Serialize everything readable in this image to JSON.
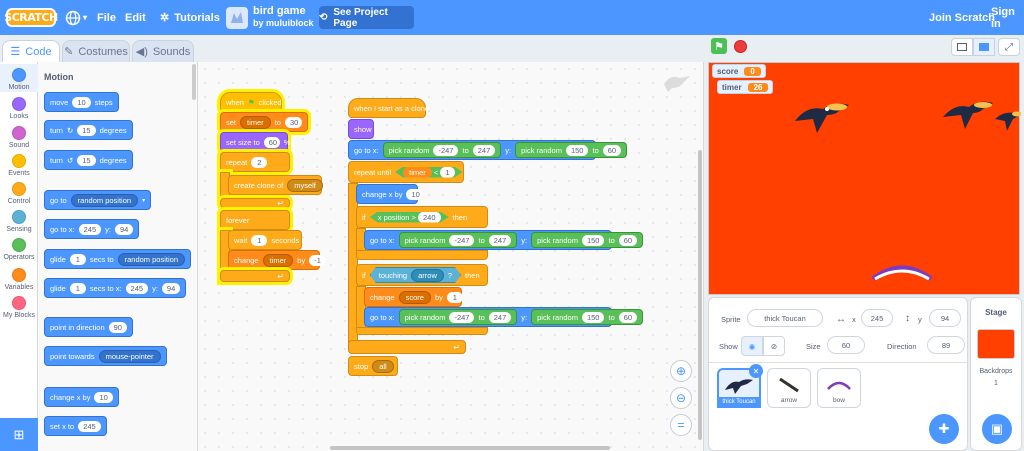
{
  "menu": {
    "logo": "SCRATCH",
    "file": "File",
    "edit": "Edit",
    "tutorials": "Tutorials",
    "project_title": "bird game",
    "project_author": "by muluiblock",
    "see_project": "See Project Page",
    "join": "Join Scratch",
    "signin": "Sign in"
  },
  "tabs": {
    "code": "Code",
    "costumes": "Costumes",
    "sounds": "Sounds"
  },
  "categories": [
    {
      "label": "Motion",
      "color": "#4c97ff"
    },
    {
      "label": "Looks",
      "color": "#9966ff"
    },
    {
      "label": "Sound",
      "color": "#cf63cf"
    },
    {
      "label": "Events",
      "color": "#ffbf00"
    },
    {
      "label": "Control",
      "color": "#ffab19"
    },
    {
      "label": "Sensing",
      "color": "#5cb1d6"
    },
    {
      "label": "Operators",
      "color": "#59c059"
    },
    {
      "label": "Variables",
      "color": "#ff8c1a"
    },
    {
      "label": "My Blocks",
      "color": "#ff6680"
    }
  ],
  "palette": {
    "heading": "Motion",
    "move": {
      "a": "move",
      "v": "10",
      "b": "steps"
    },
    "turn_right": {
      "a": "turn",
      "v": "15",
      "b": "degrees"
    },
    "turn_left": {
      "a": "turn",
      "v": "15",
      "b": "degrees"
    },
    "goto": {
      "a": "go to",
      "dd": "random position"
    },
    "goto_xy": {
      "a": "go to x:",
      "x": "245",
      "b": "y:",
      "y": "94"
    },
    "glide_to": {
      "a": "glide",
      "v": "1",
      "b": "secs to",
      "dd": "random position"
    },
    "glide_xy": {
      "a": "glide",
      "v": "1",
      "b": "secs to x:",
      "x": "245",
      "c": "y:",
      "y": "94"
    },
    "point_dir": {
      "a": "point in direction",
      "v": "90"
    },
    "point_towards": {
      "a": "point towards",
      "dd": "mouse-pointer"
    },
    "change_x": {
      "a": "change x by",
      "v": "10"
    },
    "set_x": {
      "a": "set x to",
      "v": "245"
    }
  },
  "script1": {
    "hat_a": "when",
    "hat_b": "clicked",
    "set_a": "set",
    "set_var": "timer",
    "set_to": "to",
    "set_v": "30",
    "size_a": "set size to",
    "size_v": "60",
    "size_b": "%",
    "repeat_a": "repeat",
    "repeat_v": "2",
    "clone_a": "create clone of",
    "clone_dd": "myself",
    "forever": "forever",
    "wait_a": "wait",
    "wait_v": "1",
    "wait_b": "seconds",
    "change_a": "change",
    "change_var": "timer",
    "change_by": "by",
    "change_v": "-1"
  },
  "script2": {
    "hat": "when I start as a clone",
    "show": "show",
    "goto_a": "go to x:",
    "rand_a": "pick random",
    "x1": "-247",
    "to": "to",
    "x2": "247",
    "y_lbl": "y:",
    "y1": "150",
    "y2": "60",
    "until_a": "repeat until",
    "until_var": "timer",
    "lt": "<",
    "until_v": "1",
    "chx_a": "change x by",
    "chx_v": "10",
    "if": "if",
    "then": "then",
    "xpos": "x position",
    "gt": ">",
    "xpos_v": "240",
    "touching": "touching",
    "touch_dd": "arrow",
    "q": "?",
    "chg_a": "change",
    "chg_var": "score",
    "chg_by": "by",
    "chg_v": "1",
    "stop": "stop",
    "stop_dd": "all"
  },
  "stage": {
    "monitors": [
      {
        "name": "score",
        "value": "0"
      },
      {
        "name": "timer",
        "value": "26"
      }
    ]
  },
  "sprite_info": {
    "sprite_lbl": "Sprite",
    "sprite_name": "thick Toucan",
    "x_lbl": "x",
    "x": "245",
    "y_lbl": "y",
    "y": "94",
    "show_lbl": "Show",
    "size_lbl": "Size",
    "size": "60",
    "dir_lbl": "Direction",
    "dir": "89"
  },
  "sprites": [
    {
      "name": "thick Toucan"
    },
    {
      "name": "arrow"
    },
    {
      "name": "bow"
    }
  ],
  "stage_pane": {
    "title": "Stage",
    "backdrops_lbl": "Backdrops",
    "backdrops": "1"
  }
}
